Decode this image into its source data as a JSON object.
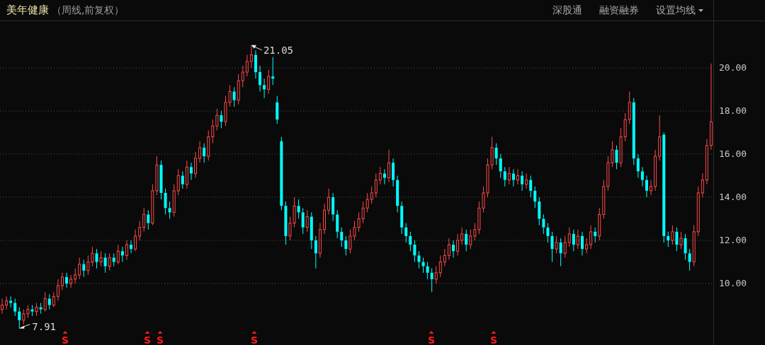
{
  "header": {
    "stock_name": "美年健康",
    "subtitle": "（周线,前复权）",
    "links": [
      {
        "label": "深股通",
        "kind": "link"
      },
      {
        "label": "融资融券",
        "kind": "link"
      },
      {
        "label": "设置均线",
        "kind": "dropdown"
      }
    ]
  },
  "chart": {
    "high_label": "21.05",
    "low_label": "7.91",
    "chart_data": {
      "type": "candlestick",
      "grid": true,
      "ylim": [
        7.15,
        22.16
      ],
      "yticks": [
        {
          "value": 20,
          "label": "20.00"
        },
        {
          "value": 18,
          "label": "18.00"
        },
        {
          "value": 16,
          "label": "16.00"
        },
        {
          "value": 14,
          "label": "14.00"
        },
        {
          "value": 12,
          "label": "12.00"
        },
        {
          "value": 10,
          "label": "10.00"
        }
      ],
      "annotations": [
        "S",
        "S",
        "S",
        "S",
        "S",
        "S"
      ],
      "ohlc": [
        [
          8.8,
          9.3,
          8.6,
          9.0
        ],
        [
          9.0,
          9.4,
          8.8,
          9.2
        ],
        [
          9.2,
          9.4,
          8.9,
          9.1
        ],
        [
          9.1,
          9.3,
          8.5,
          8.7
        ],
        [
          8.7,
          8.9,
          7.91,
          8.3
        ],
        [
          8.3,
          8.8,
          8.1,
          8.6
        ],
        [
          8.6,
          9.0,
          8.4,
          8.8
        ],
        [
          8.8,
          9.0,
          8.5,
          8.7
        ],
        [
          8.7,
          9.1,
          8.5,
          8.9
        ],
        [
          8.9,
          9.1,
          8.6,
          8.8
        ],
        [
          8.8,
          9.6,
          8.7,
          9.3
        ],
        [
          9.3,
          9.5,
          8.8,
          9.0
        ],
        [
          9.0,
          9.6,
          8.9,
          9.4
        ],
        [
          9.4,
          10.2,
          9.2,
          9.9
        ],
        [
          9.9,
          10.5,
          9.7,
          10.3
        ],
        [
          10.3,
          10.5,
          9.8,
          10.0
        ],
        [
          10.0,
          10.4,
          9.8,
          10.2
        ],
        [
          10.2,
          10.7,
          10.0,
          10.4
        ],
        [
          10.4,
          11.2,
          10.2,
          10.9
        ],
        [
          10.9,
          11.1,
          10.3,
          10.6
        ],
        [
          10.6,
          11.3,
          10.4,
          11.0
        ],
        [
          11.0,
          11.7,
          10.8,
          11.4
        ],
        [
          11.4,
          11.6,
          10.7,
          11.0
        ],
        [
          11.0,
          11.5,
          10.8,
          11.2
        ],
        [
          11.2,
          11.4,
          10.5,
          10.8
        ],
        [
          10.8,
          11.4,
          10.6,
          11.2
        ],
        [
          11.2,
          11.4,
          10.8,
          11.0
        ],
        [
          11.0,
          11.8,
          10.9,
          11.5
        ],
        [
          11.5,
          11.7,
          11.0,
          11.3
        ],
        [
          11.3,
          12.0,
          11.1,
          11.8
        ],
        [
          11.8,
          12.0,
          11.4,
          11.6
        ],
        [
          11.6,
          12.5,
          11.5,
          12.2
        ],
        [
          12.2,
          12.9,
          12.0,
          12.6
        ],
        [
          12.6,
          13.5,
          12.4,
          13.2
        ],
        [
          13.2,
          13.4,
          12.5,
          12.8
        ],
        [
          12.8,
          14.6,
          12.7,
          14.3
        ],
        [
          14.3,
          15.9,
          14.1,
          15.5
        ],
        [
          15.5,
          15.7,
          13.9,
          14.2
        ],
        [
          14.2,
          14.4,
          13.2,
          13.5
        ],
        [
          13.5,
          13.8,
          13.0,
          13.3
        ],
        [
          13.3,
          14.6,
          13.1,
          14.3
        ],
        [
          14.3,
          15.3,
          14.1,
          15.0
        ],
        [
          15.0,
          15.2,
          14.4,
          14.6
        ],
        [
          14.6,
          15.7,
          14.4,
          15.4
        ],
        [
          15.4,
          15.6,
          14.8,
          15.1
        ],
        [
          15.1,
          16.1,
          14.9,
          15.8
        ],
        [
          15.8,
          16.6,
          15.6,
          16.3
        ],
        [
          16.3,
          16.5,
          15.6,
          15.9
        ],
        [
          15.9,
          17.1,
          15.7,
          16.8
        ],
        [
          16.8,
          17.6,
          16.5,
          17.3
        ],
        [
          17.3,
          18.1,
          17.1,
          17.8
        ],
        [
          17.8,
          18.0,
          17.2,
          17.5
        ],
        [
          17.5,
          18.7,
          17.3,
          18.4
        ],
        [
          18.4,
          19.2,
          18.2,
          18.9
        ],
        [
          18.9,
          19.1,
          18.2,
          18.5
        ],
        [
          18.5,
          19.7,
          18.3,
          19.4
        ],
        [
          19.4,
          20.1,
          19.1,
          19.8
        ],
        [
          19.8,
          20.6,
          19.6,
          20.3
        ],
        [
          20.3,
          21.05,
          20.0,
          20.6
        ],
        [
          20.6,
          20.8,
          19.5,
          19.8
        ],
        [
          19.8,
          20.1,
          18.9,
          19.2
        ],
        [
          19.2,
          19.5,
          18.6,
          19.0
        ],
        [
          19.0,
          19.9,
          18.8,
          19.6
        ],
        [
          19.6,
          20.5,
          19.2,
          19.5
        ],
        [
          18.4,
          18.7,
          17.4,
          17.6
        ],
        [
          16.6,
          16.8,
          13.4,
          13.6
        ],
        [
          13.6,
          13.8,
          11.8,
          12.2
        ],
        [
          12.2,
          13.1,
          12.0,
          12.8
        ],
        [
          12.8,
          14.0,
          12.6,
          13.6
        ],
        [
          13.6,
          13.9,
          13.0,
          13.3
        ],
        [
          13.3,
          13.5,
          12.3,
          12.6
        ],
        [
          12.6,
          13.4,
          12.4,
          13.1
        ],
        [
          13.1,
          13.3,
          11.6,
          12.0
        ],
        [
          12.0,
          12.2,
          10.7,
          11.4
        ],
        [
          11.4,
          12.8,
          11.2,
          12.5
        ],
        [
          12.5,
          13.7,
          12.3,
          13.4
        ],
        [
          13.4,
          14.4,
          13.2,
          14.0
        ],
        [
          14.0,
          14.2,
          12.9,
          13.2
        ],
        [
          13.2,
          13.4,
          12.1,
          12.4
        ],
        [
          12.4,
          12.6,
          11.7,
          12.0
        ],
        [
          12.0,
          12.2,
          11.3,
          11.6
        ],
        [
          11.6,
          12.5,
          11.4,
          12.2
        ],
        [
          12.2,
          12.9,
          12.0,
          12.6
        ],
        [
          12.6,
          13.3,
          12.4,
          13.0
        ],
        [
          13.0,
          13.8,
          12.8,
          13.5
        ],
        [
          13.5,
          14.2,
          13.3,
          13.9
        ],
        [
          13.9,
          14.5,
          13.7,
          14.2
        ],
        [
          14.2,
          15.1,
          14.0,
          14.8
        ],
        [
          14.8,
          15.4,
          14.6,
          15.1
        ],
        [
          15.1,
          15.3,
          14.6,
          14.9
        ],
        [
          14.9,
          16.2,
          14.7,
          15.6
        ],
        [
          15.6,
          15.8,
          14.5,
          14.8
        ],
        [
          14.8,
          15.0,
          13.3,
          13.6
        ],
        [
          13.6,
          13.8,
          12.3,
          12.6
        ],
        [
          12.6,
          12.8,
          11.9,
          12.2
        ],
        [
          12.2,
          12.4,
          11.5,
          11.8
        ],
        [
          11.8,
          12.0,
          11.0,
          11.3
        ],
        [
          11.3,
          11.5,
          10.7,
          11.0
        ],
        [
          11.0,
          11.2,
          10.5,
          10.8
        ],
        [
          10.8,
          11.0,
          10.2,
          10.5
        ],
        [
          10.5,
          10.7,
          9.6,
          10.2
        ],
        [
          10.2,
          10.8,
          10.0,
          10.5
        ],
        [
          10.5,
          11.3,
          10.3,
          11.0
        ],
        [
          11.0,
          11.6,
          10.8,
          11.3
        ],
        [
          11.3,
          12.1,
          11.1,
          11.8
        ],
        [
          11.8,
          12.0,
          11.2,
          11.5
        ],
        [
          11.5,
          12.3,
          11.3,
          12.0
        ],
        [
          12.0,
          12.6,
          11.8,
          12.3
        ],
        [
          12.3,
          12.5,
          11.5,
          11.8
        ],
        [
          11.8,
          12.5,
          11.6,
          12.2
        ],
        [
          12.2,
          12.8,
          12.0,
          12.5
        ],
        [
          12.5,
          13.8,
          12.3,
          13.5
        ],
        [
          13.5,
          14.5,
          13.3,
          14.2
        ],
        [
          14.2,
          15.8,
          14.0,
          15.5
        ],
        [
          15.5,
          16.8,
          15.3,
          16.3
        ],
        [
          16.3,
          16.5,
          15.5,
          15.8
        ],
        [
          15.8,
          16.0,
          14.9,
          15.2
        ],
        [
          15.2,
          15.4,
          14.5,
          14.8
        ],
        [
          14.8,
          15.4,
          14.6,
          15.1
        ],
        [
          15.1,
          15.3,
          14.5,
          14.8
        ],
        [
          14.8,
          15.3,
          14.6,
          15.0
        ],
        [
          15.0,
          15.2,
          14.3,
          14.6
        ],
        [
          14.6,
          15.1,
          14.4,
          14.8
        ],
        [
          14.8,
          15.0,
          14.0,
          14.3
        ],
        [
          14.3,
          14.5,
          13.5,
          13.8
        ],
        [
          13.8,
          14.0,
          12.7,
          13.0
        ],
        [
          13.0,
          13.2,
          12.3,
          12.6
        ],
        [
          12.6,
          12.8,
          11.9,
          12.2
        ],
        [
          12.2,
          12.4,
          11.0,
          11.6
        ],
        [
          11.6,
          12.2,
          11.4,
          11.9
        ],
        [
          11.9,
          12.1,
          10.8,
          11.4
        ],
        [
          11.4,
          12.2,
          11.2,
          11.9
        ],
        [
          11.9,
          12.6,
          11.7,
          12.3
        ],
        [
          12.3,
          12.5,
          11.5,
          11.8
        ],
        [
          11.8,
          12.5,
          11.6,
          12.2
        ],
        [
          12.2,
          12.4,
          11.3,
          11.6
        ],
        [
          11.6,
          12.1,
          11.4,
          11.8
        ],
        [
          11.8,
          12.7,
          11.6,
          12.4
        ],
        [
          12.4,
          12.6,
          11.9,
          12.2
        ],
        [
          12.2,
          13.5,
          12.0,
          13.2
        ],
        [
          13.2,
          14.8,
          13.0,
          14.5
        ],
        [
          14.5,
          15.9,
          14.3,
          15.6
        ],
        [
          15.6,
          16.6,
          15.4,
          16.2
        ],
        [
          16.2,
          16.4,
          15.3,
          15.6
        ],
        [
          15.6,
          17.2,
          15.4,
          16.8
        ],
        [
          16.8,
          17.9,
          16.6,
          17.6
        ],
        [
          17.6,
          18.9,
          17.4,
          18.4
        ],
        [
          18.4,
          18.6,
          15.5,
          15.8
        ],
        [
          15.8,
          16.0,
          14.9,
          15.2
        ],
        [
          15.2,
          15.4,
          14.5,
          14.8
        ],
        [
          14.8,
          15.0,
          14.0,
          14.3
        ],
        [
          14.3,
          14.8,
          14.1,
          14.5
        ],
        [
          14.5,
          16.2,
          14.3,
          15.9
        ],
        [
          15.9,
          17.8,
          15.7,
          16.8
        ],
        [
          16.9,
          17.0,
          11.9,
          12.2
        ],
        [
          12.2,
          12.4,
          11.7,
          12.0
        ],
        [
          12.0,
          12.7,
          11.8,
          12.4
        ],
        [
          12.4,
          12.6,
          11.5,
          11.8
        ],
        [
          11.8,
          12.4,
          11.6,
          12.1
        ],
        [
          12.1,
          12.3,
          11.1,
          11.4
        ],
        [
          11.4,
          11.6,
          10.6,
          11.0
        ],
        [
          11.0,
          12.7,
          10.8,
          12.4
        ],
        [
          12.4,
          14.5,
          12.2,
          14.2
        ],
        [
          14.2,
          15.1,
          14.0,
          14.8
        ],
        [
          14.8,
          16.7,
          14.6,
          16.4
        ],
        [
          16.4,
          20.2,
          16.2,
          17.5
        ]
      ]
    }
  }
}
